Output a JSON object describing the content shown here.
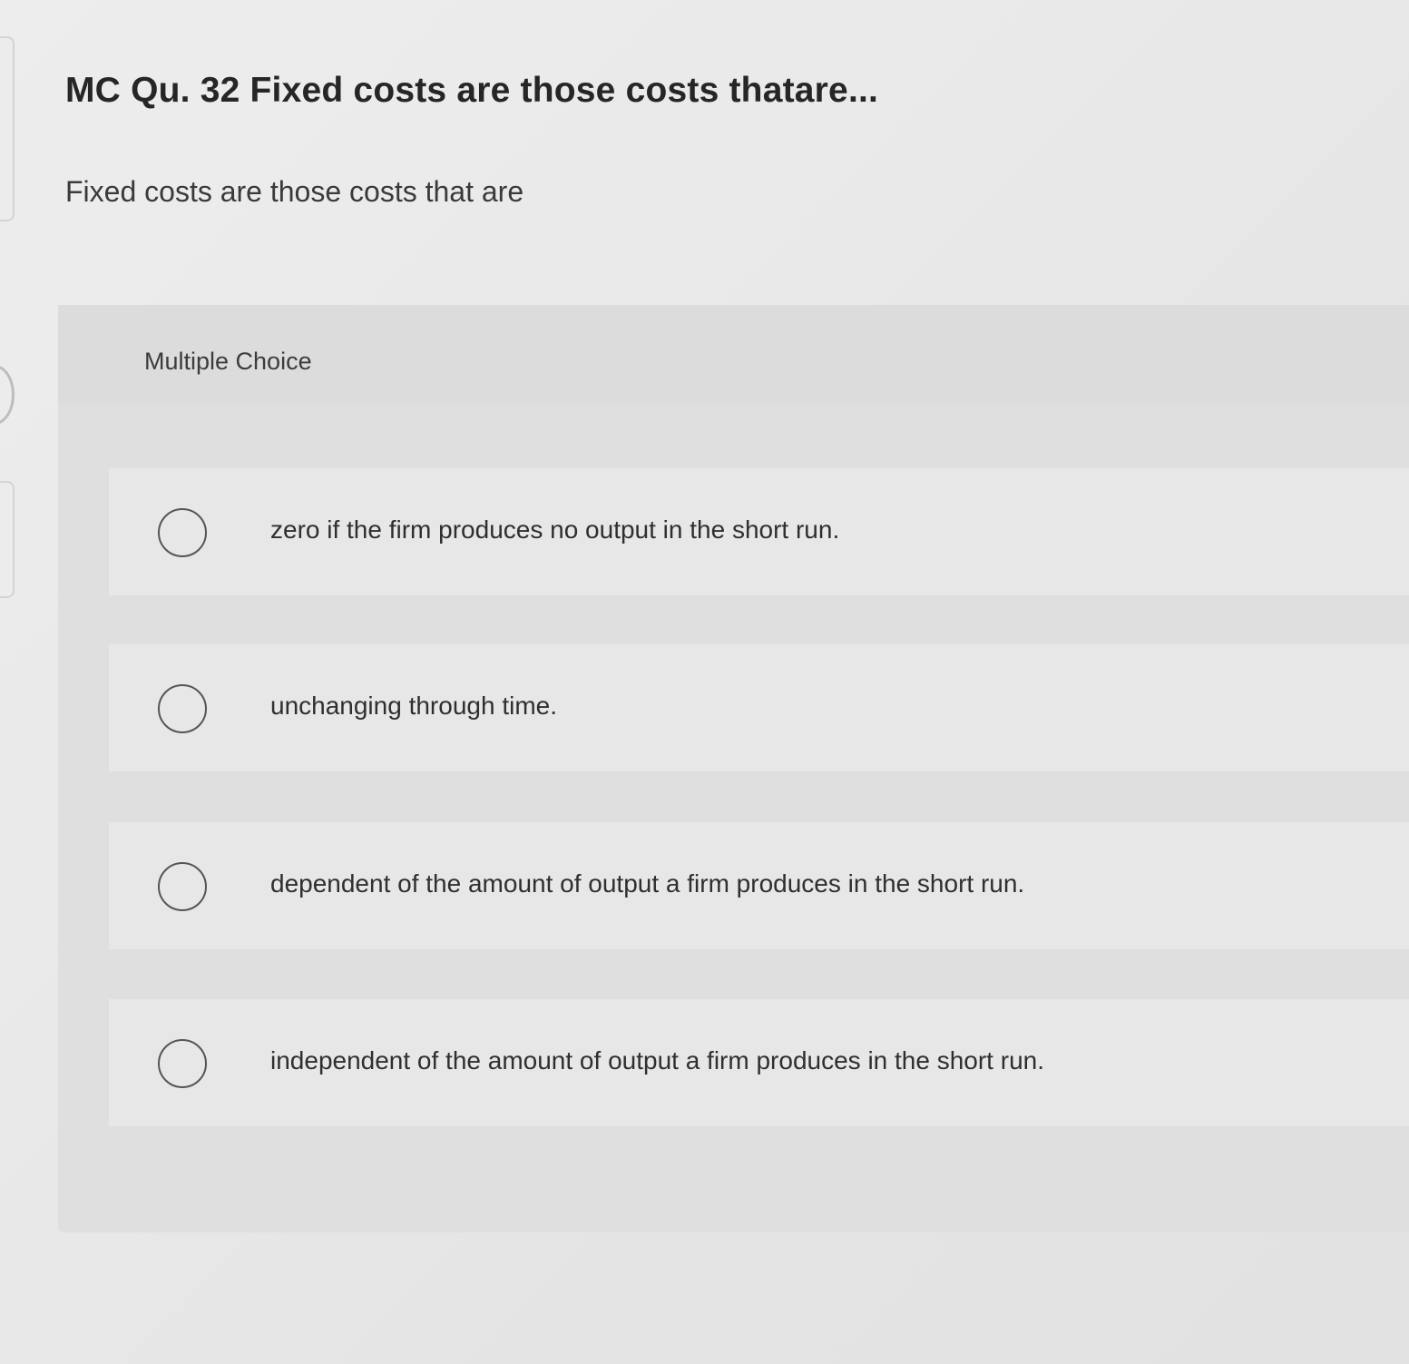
{
  "question": {
    "title": "MC Qu. 32 Fixed costs are those costs thatare...",
    "prompt": "Fixed costs are those costs that are"
  },
  "choices_panel": {
    "label": "Multiple Choice",
    "options": [
      {
        "text": "zero if the firm produces no output in the short run.",
        "selected": false
      },
      {
        "text": "unchanging through time.",
        "selected": false
      },
      {
        "text": "dependent of the amount of output a firm produces in the short run.",
        "selected": false
      },
      {
        "text": "independent of the amount of output a firm produces in the short run.",
        "selected": false
      }
    ]
  }
}
